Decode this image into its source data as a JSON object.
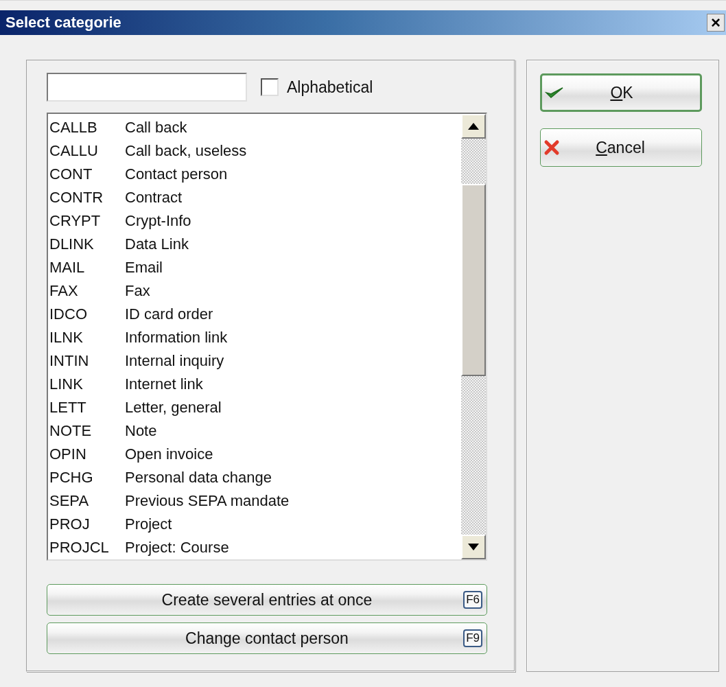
{
  "window": {
    "title": "Select categorie",
    "close": "×"
  },
  "alphabetical": {
    "label": "Alphabetical",
    "checked": false
  },
  "categories": [
    {
      "code": "CALLB",
      "name": "Call back"
    },
    {
      "code": "CALLU",
      "name": "Call back, useless"
    },
    {
      "code": "CONT",
      "name": "Contact person"
    },
    {
      "code": "CONTR",
      "name": "Contract"
    },
    {
      "code": "CRYPT",
      "name": "Crypt-Info"
    },
    {
      "code": "DLINK",
      "name": "Data Link"
    },
    {
      "code": "MAIL",
      "name": "Email"
    },
    {
      "code": "FAX",
      "name": "Fax"
    },
    {
      "code": "IDCO",
      "name": "ID card order"
    },
    {
      "code": "ILNK",
      "name": "Information link"
    },
    {
      "code": "INTIN",
      "name": "Internal inquiry"
    },
    {
      "code": "LINK",
      "name": "Internet link"
    },
    {
      "code": "LETT",
      "name": "Letter, general"
    },
    {
      "code": "NOTE",
      "name": "Note"
    },
    {
      "code": "OPIN",
      "name": "Open invoice"
    },
    {
      "code": "PCHG",
      "name": "Personal data change"
    },
    {
      "code": "SEPA",
      "name": "Previous SEPA mandate"
    },
    {
      "code": "PROJ",
      "name": "Project"
    },
    {
      "code": "PROJCL",
      "name": "Project: Course"
    }
  ],
  "actions": [
    {
      "label": "Create several entries at once",
      "key": "F6"
    },
    {
      "label": "Change contact person",
      "key": "F9"
    }
  ],
  "dialog_buttons": [
    {
      "kind": "ok",
      "label": "OK",
      "accelerator_first": true,
      "default": true
    },
    {
      "kind": "cancel",
      "label": "Cancel",
      "accelerator_first": true,
      "default": false
    }
  ]
}
